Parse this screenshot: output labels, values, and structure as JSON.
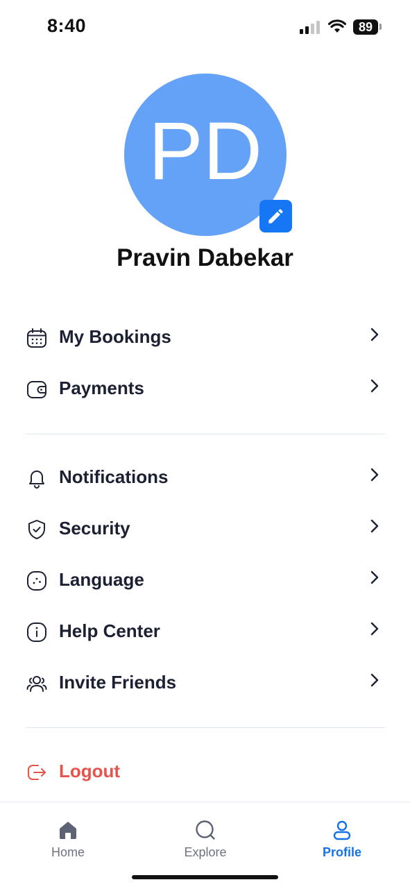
{
  "status_bar": {
    "time": "8:40",
    "battery": "89"
  },
  "profile": {
    "initials": "PD",
    "name": "Pravin Dabekar",
    "avatar_color": "#64a2f8",
    "edit_icon": "pencil-icon"
  },
  "menu_group_1": [
    {
      "label": "My Bookings",
      "icon": "calendar-icon"
    },
    {
      "label": "Payments",
      "icon": "wallet-icon"
    }
  ],
  "menu_group_2": [
    {
      "label": "Notifications",
      "icon": "bell-icon"
    },
    {
      "label": "Security",
      "icon": "shield-check-icon"
    },
    {
      "label": "Language",
      "icon": "language-icon"
    },
    {
      "label": "Help Center",
      "icon": "info-icon"
    },
    {
      "label": "Invite Friends",
      "icon": "users-icon"
    }
  ],
  "logout": {
    "label": "Logout",
    "color": "#e5534b"
  },
  "bottom_nav": [
    {
      "label": "Home",
      "icon": "home-icon",
      "active": false
    },
    {
      "label": "Explore",
      "icon": "search-icon",
      "active": false
    },
    {
      "label": "Profile",
      "icon": "user-icon",
      "active": true
    }
  ],
  "colors": {
    "accent": "#1471e8",
    "text": "#1c2033"
  }
}
